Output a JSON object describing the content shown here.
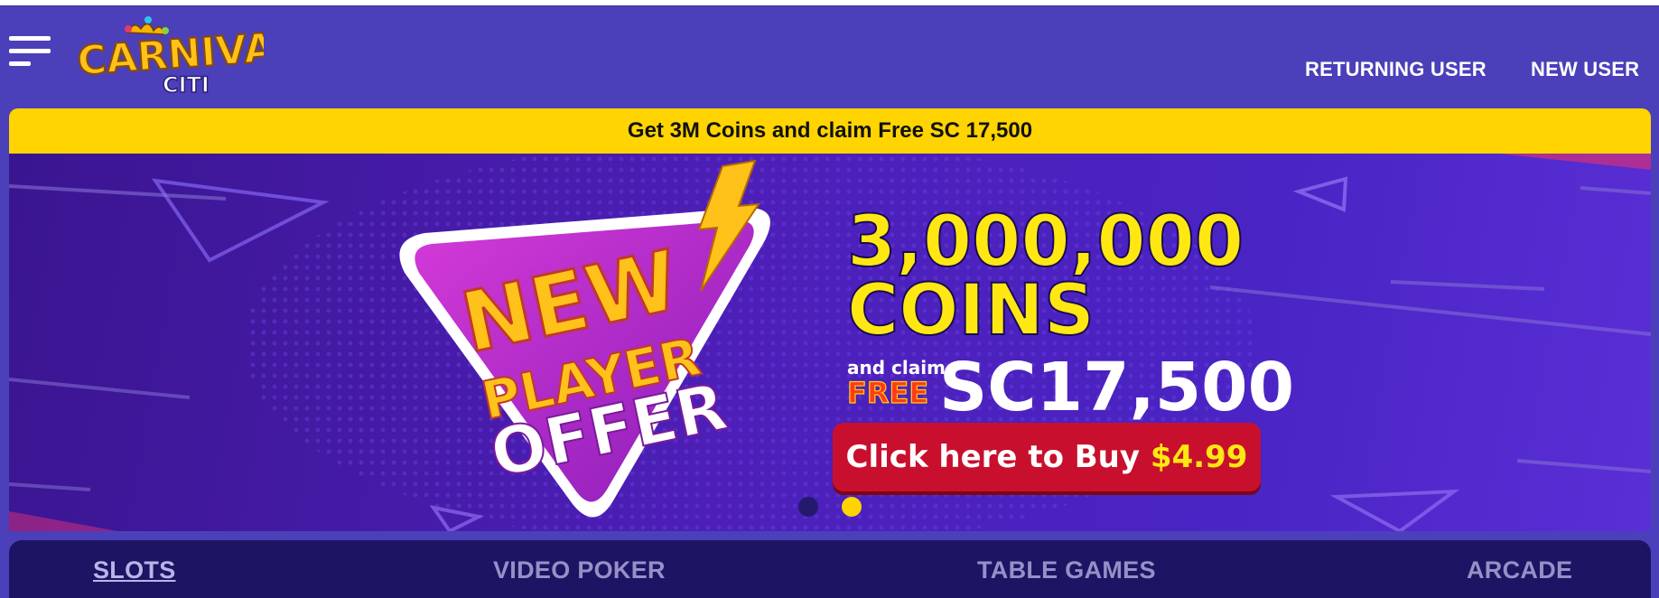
{
  "header": {
    "logo": {
      "line1": "CARNIVAL",
      "line2": "CITI"
    },
    "returning_user": "RETURNING USER",
    "new_user": "NEW USER"
  },
  "promo": {
    "text": "Get 3M Coins and claim Free SC 17,500"
  },
  "banner": {
    "badge_new": "NEW",
    "badge_player": "PLAYER",
    "badge_offer": "OFFER",
    "coins_amount": "3,000,000",
    "coins_label": "COINS",
    "and_claim": "and claim",
    "free": "FREE",
    "sc_amount": "SC17,500",
    "cta_text": "Click here to Buy ",
    "cta_price": "$4.99",
    "slide_count": 2,
    "active_slide": 2
  },
  "categories": [
    {
      "label": "SLOTS",
      "active": true
    },
    {
      "label": "VIDEO POKER",
      "active": false
    },
    {
      "label": "TABLE GAMES",
      "active": false
    },
    {
      "label": "ARCADE",
      "active": false
    }
  ],
  "colors": {
    "header_bg": "#4b40b9",
    "promo_yellow": "#ffd400",
    "category_bg": "#1e1464",
    "cta_red": "#c8102e",
    "badge_magenta": "#b02bd0"
  },
  "icons": {
    "menu": "hamburger-menu-icon",
    "bolt": "lightning-bolt-icon"
  }
}
